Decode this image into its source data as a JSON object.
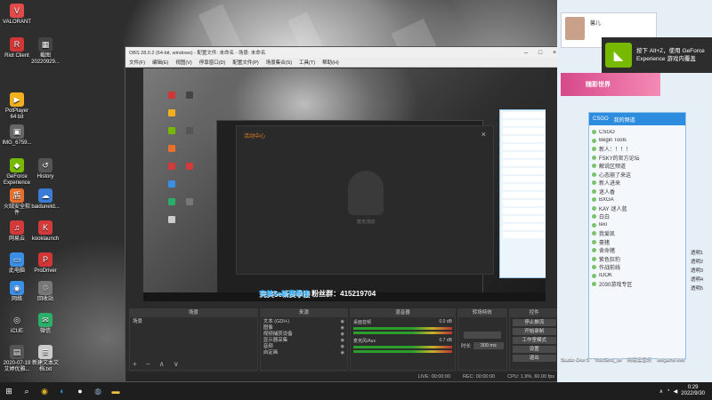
{
  "desktop_icons": [
    {
      "label": "VALORANT",
      "color": "#e24a4a",
      "glyph": "V"
    },
    {
      "label": "Riot Client",
      "color": "#d23535",
      "glyph": "R"
    },
    {
      "label": "截图 20220929...",
      "color": "#444444",
      "glyph": "▦"
    },
    {
      "label": "PotPlayer 64 bit",
      "color": "#f2b01e",
      "glyph": "▶"
    },
    {
      "label": "IMG_6759...",
      "color": "#666666",
      "glyph": "▣"
    },
    {
      "label": "GeForce Experience",
      "color": "#76b900",
      "glyph": "◆"
    },
    {
      "label": "History",
      "color": "#555555",
      "glyph": "↺"
    },
    {
      "label": "火绒安全软件",
      "color": "#e8702a",
      "glyph": "盾"
    },
    {
      "label": "baidunetd...",
      "color": "#3a7bd5",
      "glyph": "☁"
    },
    {
      "label": "网易云",
      "color": "#d33a3a",
      "glyph": "♫"
    },
    {
      "label": "kooklaunch",
      "color": "#d33a3a",
      "glyph": "K"
    },
    {
      "label": "此电脑",
      "color": "#3a8ee6",
      "glyph": "▭"
    },
    {
      "label": "ProDriver",
      "color": "#d23535",
      "glyph": "P"
    },
    {
      "label": "网络",
      "color": "#3a8ee6",
      "glyph": "◉"
    },
    {
      "label": "回收站",
      "color": "#777777",
      "glyph": "♲"
    },
    {
      "label": "iCUE",
      "color": "#3a3a3a",
      "glyph": "◎"
    },
    {
      "label": "微信",
      "color": "#2aae67",
      "glyph": "✉"
    },
    {
      "label": "2020-07-19 艾婷优雅...",
      "color": "#555555",
      "glyph": "▤"
    },
    {
      "label": "新建文本文档.txt",
      "color": "#cccccc",
      "glyph": "≣"
    }
  ],
  "obs": {
    "title": "OBS 28.0.2 (64-bit, windows) - 配置文件: 未命名 - 场景: 未命名",
    "menu": [
      "文件(F)",
      "编辑(E)",
      "视图(V)",
      "停靠窗口(D)",
      "配置文件(P)",
      "场景集合(S)",
      "工具(T)",
      "帮助(H)"
    ],
    "dialog_title": "活动中心",
    "dialog_logo_text": "暂无活动",
    "docks": {
      "scenes": {
        "title": "场景",
        "items": [
          "场景"
        ]
      },
      "sources": {
        "title": "来源",
        "items": [
          "文本 (GDI+)",
          "图像",
          "视频捕获设备",
          "显示器采集",
          "音频",
          "自定画"
        ]
      },
      "mixer": {
        "title": "混音器",
        "channels": [
          {
            "name": "桌面音频",
            "level": "0.0 dB"
          },
          {
            "name": "麦克风/Aux",
            "level": "0.7 dB"
          }
        ]
      },
      "transitions": {
        "title": "转场特效",
        "duration_label": "时长",
        "duration": "300 ms"
      },
      "controls": {
        "title": "控件",
        "buttons": [
          "停止推流",
          "开始录制",
          "工作室模式",
          "设置",
          "退出"
        ]
      }
    },
    "status": {
      "live": "LIVE: 00:00:00",
      "rec": "REC: 00:00:00",
      "cpu": "CPU: 1.9%, 60.00 fps"
    }
  },
  "banner": {
    "part1": "完美5e新赛季接",
    "part2": "粉丝群：415219704"
  },
  "notification": {
    "line1": "按下 Alt+Z，使用 GeForce",
    "line2": "Experience 游戏内覆盖"
  },
  "promo": {
    "text": "随彩世界"
  },
  "user_card": {
    "name": "馨儿"
  },
  "qq": {
    "header": "CSGO",
    "tab1": "我的频道",
    "members": [
      "CSGO",
      "Begin Tools",
      "新人：！！！",
      "FSKY的官方论坛",
      "解说区频道",
      "心态崩了来这",
      "新人进来",
      "迷人香",
      "BXGA",
      "KAY·迷人蓝",
      "白白",
      "lexi",
      "我爱凯",
      "豪猪",
      "舍命猪",
      "紫色狂豹",
      "作战前线",
      "IOOK",
      "2030游戏专区"
    ]
  },
  "side_users": [
    "透明1",
    "透明2",
    "透明3",
    "透明4",
    "透明5"
  ],
  "right_bottom": [
    "Studio One 5",
    "YoloSent_se",
    "网易云音乐",
    "wegame.exe"
  ],
  "taskbar": {
    "icons": [
      "windows-icon",
      "search-icon",
      "chrome-icon",
      "edge-icon",
      "obs-icon",
      "steam-icon",
      "explorer-icon"
    ],
    "time": "0:29",
    "date": "2022/9/30"
  }
}
